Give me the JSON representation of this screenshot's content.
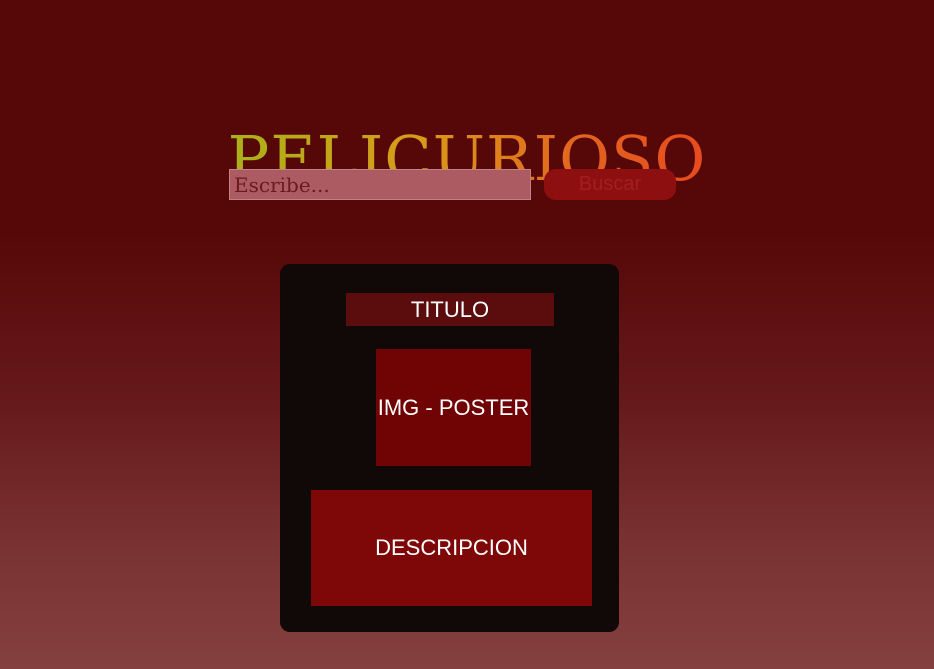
{
  "header": {
    "logo_text": "PELICURIOSO"
  },
  "search": {
    "placeholder": "Escribe...",
    "value": "",
    "button_label": "Buscar"
  },
  "movie_card": {
    "title": "TITULO",
    "poster_placeholder": "IMG - POSTER",
    "description": "DESCRIPCION"
  },
  "colors": {
    "background_top": "#560808",
    "background_bottom": "#843f3f",
    "logo_gradient_start": "#a9b218",
    "logo_gradient_end": "#e84a1e",
    "search_input_bg": "#ab5b61",
    "search_button_bg": "#8e0f10",
    "card_bg": "#110808",
    "title_bg": "#5b0c0c",
    "poster_bg": "#700303",
    "description_bg": "#7e0707"
  }
}
